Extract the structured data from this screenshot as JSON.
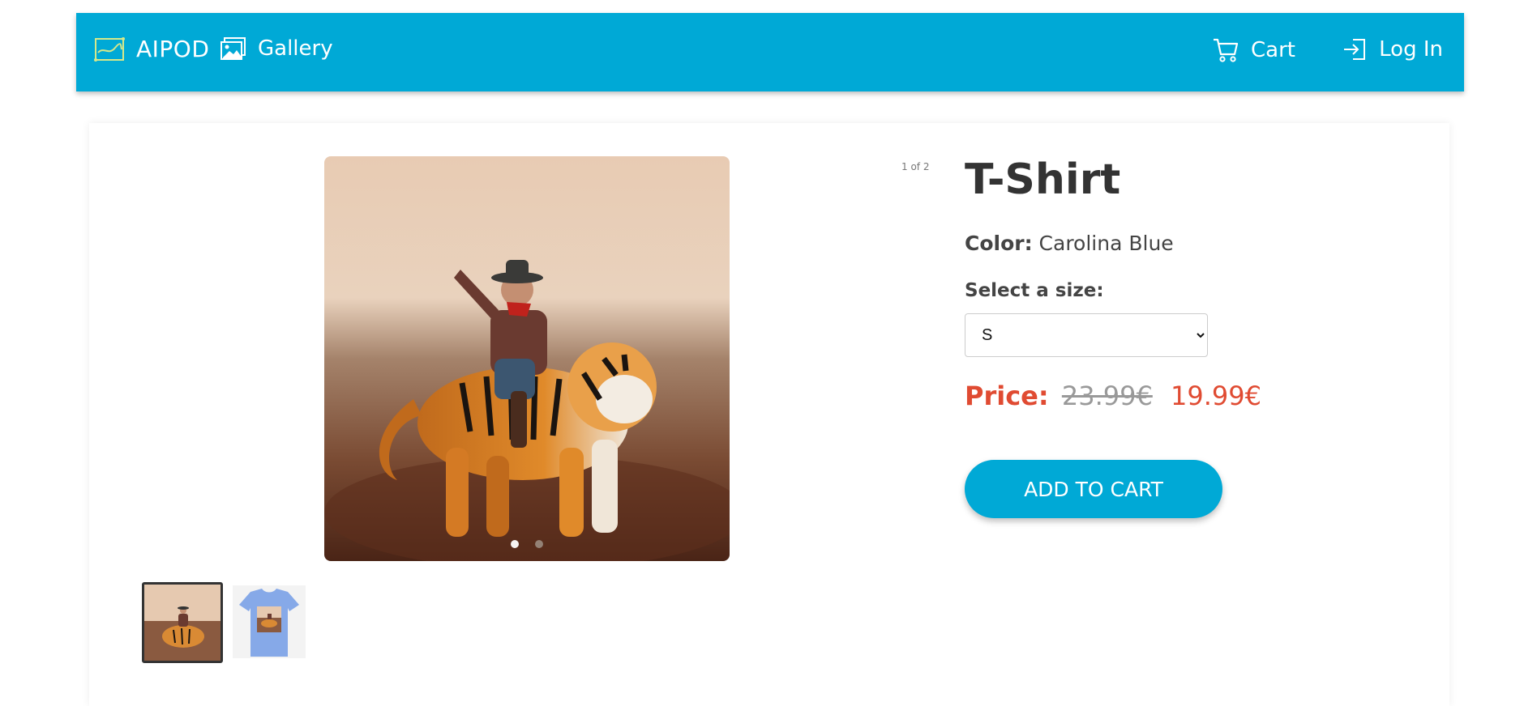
{
  "nav": {
    "brand": "AIPOD",
    "gallery": "Gallery",
    "cart": "Cart",
    "login": "Log In",
    "background": "#00a9d6"
  },
  "product": {
    "image_counter": "1 of 2",
    "title": "T-Shirt",
    "color_label": "Color:",
    "color_value": "Carolina Blue",
    "size_label": "Select a size:",
    "size_selected": "S",
    "price_label": "Price:",
    "price_old": "23.99€",
    "price_new": "19.99€",
    "add_to_cart": "ADD TO CART",
    "price_color": "#e04b32"
  },
  "gallery": {
    "images": [
      {
        "name": "cowboy-riding-tiger-image",
        "active": true
      },
      {
        "name": "tshirt-mockup-image",
        "active": false
      }
    ]
  }
}
